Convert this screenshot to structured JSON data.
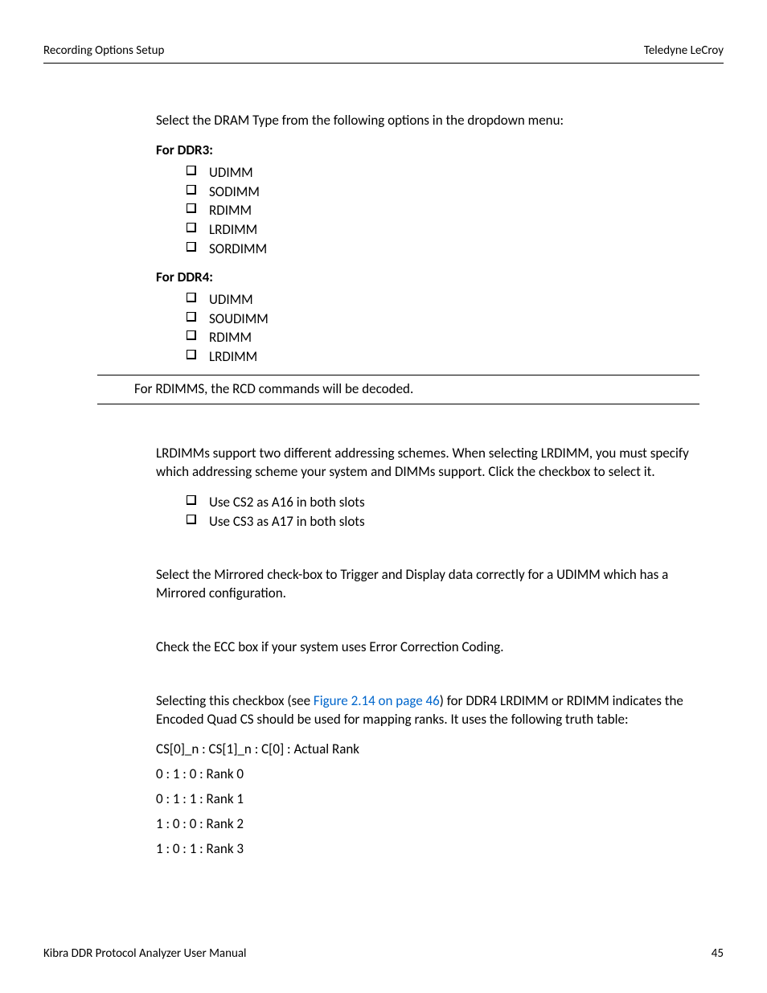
{
  "header": {
    "left": "Recording Options Setup",
    "right": "Teledyne LeCroy"
  },
  "intro": "Select the DRAM Type from the following options in the dropdown menu:",
  "ddr3": {
    "heading": "For DDR3:",
    "items": [
      "UDIMM",
      "SODIMM",
      "RDIMM",
      "LRDIMM",
      "SORDIMM"
    ]
  },
  "ddr4": {
    "heading": "For DDR4:",
    "items": [
      "UDIMM",
      "SOUDIMM",
      "RDIMM",
      "LRDIMM"
    ]
  },
  "note": "For RDIMMS, the RCD commands will be decoded.",
  "lrdimm_text": "LRDIMMs support two different addressing schemes. When selecting LRDIMM, you must specify which addressing scheme your system and DIMMs support. Click the checkbox to select it.",
  "lrdimm_items": [
    "Use CS2 as A16 in both slots",
    "Use CS3 as A17 in both slots"
  ],
  "mirrored": "Select the Mirrored check-box to Trigger and Display data correctly for a UDIMM which has a Mirrored configuration.",
  "ecc": "Check the ECC box if your system uses Error Correction Coding.",
  "quadcs": {
    "pre": "Selecting this checkbox (see ",
    "link": "Figure 2.14 on page 46",
    "post": ") for DDR4 LRDIMM or RDIMM indicates the Encoded Quad CS should be used for mapping ranks. It uses the following truth table:"
  },
  "truth_header": "CS[0]_n : CS[1]_n : C[0] : Actual Rank",
  "truth_rows": [
    "0 : 1 : 0 : Rank 0",
    "0 : 1 : 1 : Rank 1",
    "1 : 0 : 0 : Rank 2",
    "1 : 0 : 1 : Rank 3"
  ],
  "footer": {
    "left": "Kibra DDR Protocol Analyzer User Manual",
    "right": "45"
  }
}
